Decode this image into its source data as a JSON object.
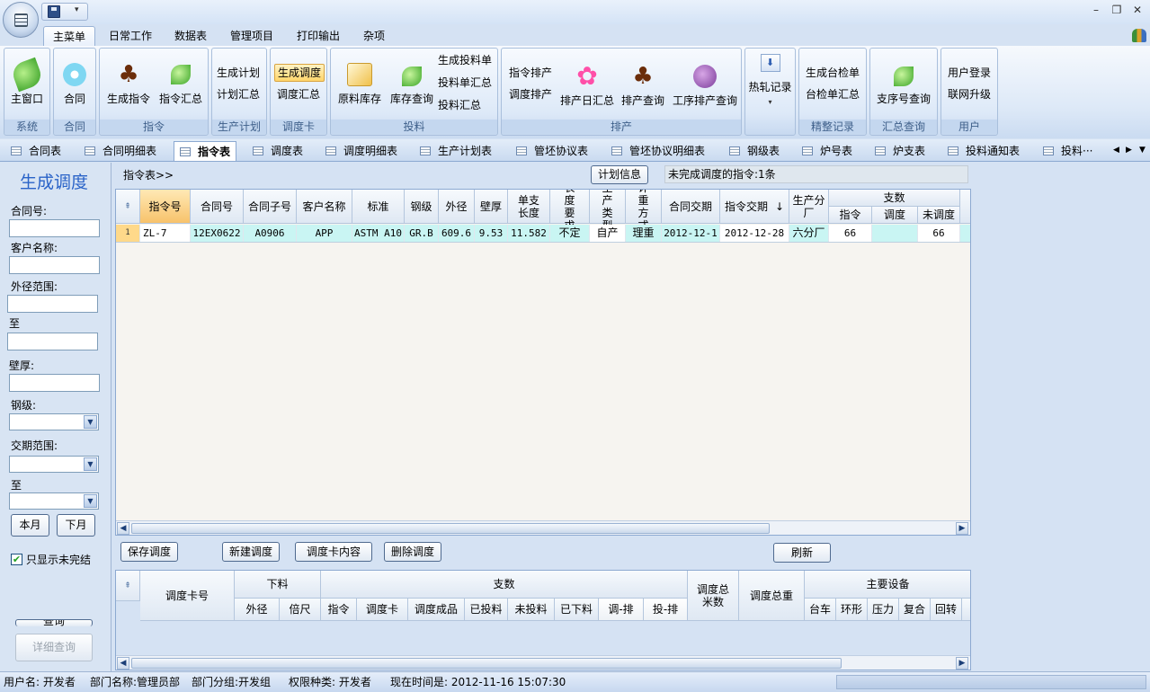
{
  "ribbon_tabs": [
    "主菜单",
    "日常工作",
    "数据表",
    "管理项目",
    "打印输出",
    "杂项"
  ],
  "groups": {
    "system": {
      "label": "系统",
      "btn": "主窗口"
    },
    "contract": {
      "label": "合同",
      "btn": "合同"
    },
    "order": {
      "label": "指令",
      "btn1": "生成指令",
      "btn2": "指令汇总"
    },
    "plan": {
      "label": "生产计划",
      "btn1": "生成计划",
      "btn2": "计划汇总"
    },
    "dispatch": {
      "label": "调度卡",
      "btn1": "生成调度",
      "btn2": "调度汇总"
    },
    "feed": {
      "label": "投料",
      "btn1": "原料库存",
      "btn2": "库存查询",
      "s1": "生成投料单",
      "s2": "投料单汇总",
      "s3": "投料汇总"
    },
    "schedule": {
      "label": "排产",
      "s1": "指令排产",
      "s2": "调度排产",
      "btn1": "排产日汇总",
      "btn2": "排产查询",
      "btn3": "工序排产查询"
    },
    "hotroll": {
      "btn": "热轧记录"
    },
    "finish": {
      "label": "精整记录",
      "s1": "生成台检单",
      "s2": "台检单汇总"
    },
    "summary": {
      "label": "汇总查询",
      "btn": "支序号查询"
    },
    "user": {
      "label": "用户",
      "s1": "用户登录",
      "s2": "联网升级"
    }
  },
  "doc_tabs": [
    "合同表",
    "合同明细表",
    "指令表",
    "调度表",
    "调度明细表",
    "生产计划表",
    "管坯协议表",
    "管坯协议明细表",
    "钢级表",
    "炉号表",
    "炉支表",
    "投料通知表",
    "投料···"
  ],
  "left": {
    "title": "生成调度",
    "contract_no": "合同号:",
    "customer": "客户名称:",
    "od_range": "外径范围:",
    "to": "至",
    "wall": "壁厚:",
    "grade": "钢级:",
    "due_range": "交期范围:",
    "to2": "至",
    "this_month": "本月",
    "next_month": "下月",
    "only_unfinished": "只显示未完结",
    "query": "查询",
    "detail_query": "详细查询"
  },
  "main": {
    "breadcrumb": "指令表>>",
    "plan_info": "计划信息",
    "status_msg": "未完成调度的指令:1条"
  },
  "grid1": {
    "headers": [
      "指令号",
      "合同号",
      "合同子号",
      "客户名称",
      "标准",
      "钢级",
      "外径",
      "壁厚",
      "单支长度",
      "长度要求",
      "生产类型",
      "计重方式",
      "合同交期",
      "指令交期",
      "生产分厂",
      "支数",
      "指令",
      "调度",
      "未调度"
    ],
    "sort_arrow": "↓",
    "row": {
      "idx": "1",
      "order_no": "ZL-7",
      "contract_no": "12EX0622",
      "sub_no": "A0906",
      "customer": "APP",
      "standard": "ASTM A10",
      "grade": "GR.B",
      "od": "609.6",
      "wall": "9.53",
      "length": "11.582",
      "len_req": "不定",
      "prod_type": "自产",
      "weigh": "理重",
      "contract_due": "2012-12-1",
      "order_due": "2012-12-28",
      "plant": "六分厂",
      "qty_order": "66",
      "qty_dispatch": "",
      "qty_left": "66"
    }
  },
  "actions": {
    "save": "保存调度",
    "new": "新建调度",
    "content": "调度卡内容",
    "delete": "删除调度",
    "refresh": "刷新"
  },
  "grid2": {
    "headers": [
      "调度卡号",
      "下料",
      "外径",
      "倍尺",
      "支数",
      "指令",
      "调度卡",
      "调度成品",
      "已投料",
      "未投料",
      "已下料",
      "调-排",
      "投-排",
      "调度总米数",
      "调度总重",
      "主要设备",
      "台车",
      "环形",
      "压力",
      "复合",
      "回转"
    ]
  },
  "status": {
    "user": "用户名: 开发者",
    "dept": "部门名称:管理员部",
    "group": "部门分组:开发组",
    "role": "权限种类: 开发者",
    "time": "现在时间是: 2012-11-16 15:07:30"
  }
}
